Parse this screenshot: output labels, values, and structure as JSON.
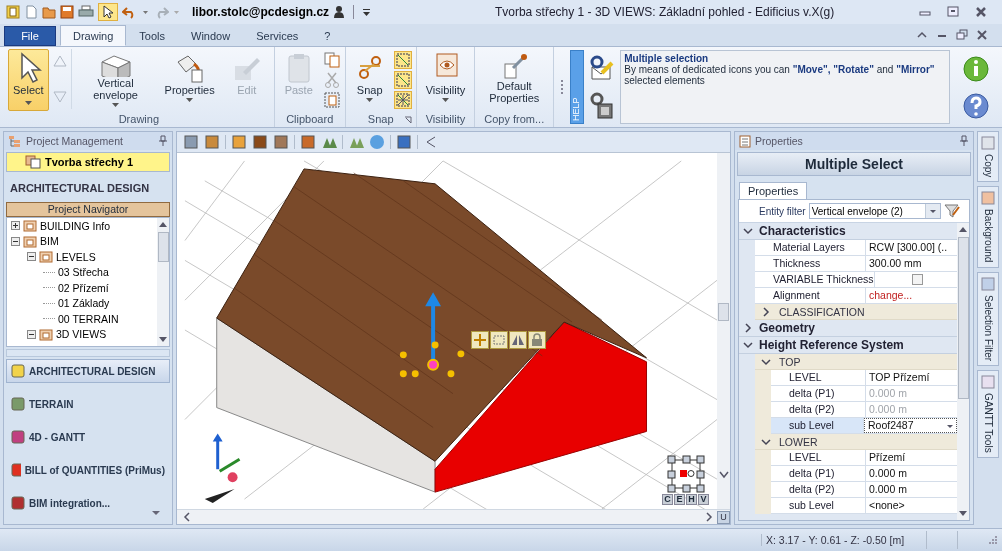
{
  "window": {
    "title": "Tvorba střechy 1 -  3D VIEWS: Základní pohled - Edificius v.X(g)",
    "user": "libor.stolc@pcdesign.cz"
  },
  "tabs": [
    {
      "label": "File",
      "kind": "file",
      "selected": false
    },
    {
      "label": "Drawing",
      "kind": "tab",
      "selected": true
    },
    {
      "label": "Tools",
      "kind": "tab",
      "selected": false
    },
    {
      "label": "Window",
      "kind": "tab",
      "selected": false
    },
    {
      "label": "Services",
      "kind": "tab",
      "selected": false
    },
    {
      "label": "?",
      "kind": "tab",
      "selected": false
    }
  ],
  "ribbon": {
    "groups": [
      {
        "label": "Drawing",
        "buttons": [
          {
            "label": "Select",
            "selected": true,
            "disabled": false,
            "dropdown": true
          },
          {
            "label": "Vertical envelope",
            "selected": false,
            "disabled": false,
            "dropdown": true
          },
          {
            "label": "Properties",
            "selected": false,
            "disabled": false,
            "dropdown": true
          },
          {
            "label": "Edit",
            "selected": false,
            "disabled": true
          }
        ]
      },
      {
        "label": "Clipboard",
        "buttons": [
          {
            "label": "Paste",
            "selected": false,
            "disabled": true
          }
        ]
      },
      {
        "label": "Snap",
        "buttons": [
          {
            "label": "Snap",
            "selected": false,
            "disabled": false,
            "dropdown": true
          }
        ],
        "toggles": [
          {
            "on": true
          },
          {
            "on": true
          },
          {
            "on": true
          }
        ]
      },
      {
        "label": "Visibility",
        "buttons": [
          {
            "label": "Visibility",
            "selected": false,
            "disabled": false,
            "dropdown": true
          }
        ]
      },
      {
        "label": "Copy from...",
        "buttons": [
          {
            "label": "Default Properties",
            "selected": false,
            "disabled": false
          }
        ]
      }
    ]
  },
  "help": {
    "tab": "HELP",
    "title": "Multiple selection",
    "text": "By means of dedicated icons you can **\"Move\", \"Rotate\"** and **\"Mirror\"** selected elements"
  },
  "project_management": {
    "title": "Project Management",
    "project": "Tvorba střechy 1",
    "section": "ARCHITECTURAL DESIGN",
    "navigator": "Project Navigator",
    "tree": [
      {
        "label": "BUILDING Info",
        "expanded": false
      },
      {
        "label": "BIM",
        "expanded": true,
        "children": [
          {
            "label": "LEVELS",
            "expanded": true,
            "children": [
              {
                "label": "03 Střecha"
              },
              {
                "label": "02 Přízemí"
              },
              {
                "label": "01 Základy"
              },
              {
                "label": "00 TERRAIN"
              }
            ]
          },
          {
            "label": "3D VIEWS",
            "expanded": true
          }
        ]
      }
    ],
    "modules": [
      {
        "label": "ARCHITECTURAL DESIGN",
        "selected": true
      },
      {
        "label": "TERRAIN",
        "selected": false
      },
      {
        "label": "4D - GANTT",
        "selected": false
      },
      {
        "label": "BILL of QUANTITIES (PriMus)",
        "selected": false
      },
      {
        "label": "BIM integration...",
        "selected": false
      }
    ]
  },
  "viewport": {
    "view_buttons": [
      "C",
      "E",
      "H",
      "V"
    ],
    "corner_button": "U"
  },
  "properties": {
    "title": "Properties",
    "heading": "Multiple Select",
    "tab": "Properties",
    "filter_label": "Entity filter",
    "filter_value": "Vertical envelope (2)",
    "categories": [
      {
        "name": "Characteristics",
        "expanded": true,
        "rows": [
          {
            "label": "Material Layers",
            "value": "RCW [300.00]   (..",
            "kind": "text",
            "disabled": false,
            "selected": false
          },
          {
            "label": "Thickness",
            "value": "300.00 mm",
            "kind": "text",
            "disabled": false,
            "selected": false
          },
          {
            "label": "VARIABLE Thickness",
            "kind": "checkbox",
            "checked": false,
            "disabled": false,
            "selected": false
          },
          {
            "label": "Alignment",
            "value": "change...",
            "kind": "link",
            "disabled": false,
            "selected": false
          }
        ],
        "groups": [
          {
            "name": "CLASSIFICATION",
            "expanded": false
          }
        ]
      },
      {
        "name": "Geometry",
        "expanded": false
      },
      {
        "name": "Height Reference System",
        "expanded": true,
        "groups": [
          {
            "name": "TOP",
            "expanded": true,
            "rows": [
              {
                "label": "LEVEL",
                "value": "TOP Přízemí",
                "kind": "text",
                "disabled": false,
                "selected": false
              },
              {
                "label": "delta (P1)",
                "value": "0.000 m",
                "kind": "text",
                "disabled": true,
                "selected": false
              },
              {
                "label": "delta (P2)",
                "value": "0.000 m",
                "kind": "text",
                "disabled": true,
                "selected": false
              },
              {
                "label": "sub Level",
                "value": "Roof2487",
                "kind": "dropdown",
                "disabled": false,
                "selected": true
              }
            ]
          },
          {
            "name": "LOWER",
            "expanded": true,
            "rows": [
              {
                "label": "LEVEL",
                "value": "Přízemí",
                "kind": "text",
                "disabled": false,
                "selected": false
              },
              {
                "label": "delta (P1)",
                "value": "0.000 m",
                "kind": "text",
                "disabled": false,
                "selected": false
              },
              {
                "label": "delta (P2)",
                "value": "0.000 m",
                "kind": "text",
                "disabled": false,
                "selected": false
              },
              {
                "label": "sub Level",
                "value": "<none>",
                "kind": "text",
                "disabled": false,
                "selected": false
              }
            ]
          }
        ]
      }
    ]
  },
  "side_tabs": [
    "Copy",
    "Background",
    "Selection Filter",
    "GANTT Tools"
  ],
  "status_bar": {
    "coordinates": "X: 3.17 - Y: 0.61 - Z: -0.50 [m]"
  }
}
